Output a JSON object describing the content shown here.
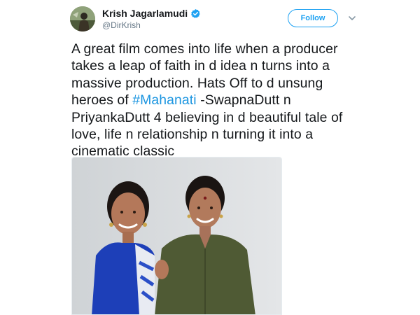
{
  "tweet": {
    "author": {
      "display_name": "Krish Jagarlamudi",
      "handle": "@DirKrish",
      "verified": true,
      "avatar_icon": "avatar-photo",
      "verified_icon": "verified-badge-icon"
    },
    "follow_label": "Follow",
    "menu_icon": "chevron-down-icon",
    "text_lines": [
      "A great film comes into life when a producer",
      "takes a leap of faith in d idea n turns into a",
      "massive production. Hats Off to d unsung",
      "heroes of ",
      "PriyankaDutt 4 believing in d beautiful tale of",
      "love, life n relationship n turning it into a",
      "cinematic classic"
    ],
    "hashtag": "#Mahanati",
    "line4_suffix": " -SwapnaDutt n",
    "media": {
      "type": "photo",
      "description_icon": "photo-two-women"
    }
  },
  "colors": {
    "accent": "#1da1f2",
    "hashtag": "#1b95e0",
    "text": "#14171a",
    "secondary": "#657786"
  }
}
